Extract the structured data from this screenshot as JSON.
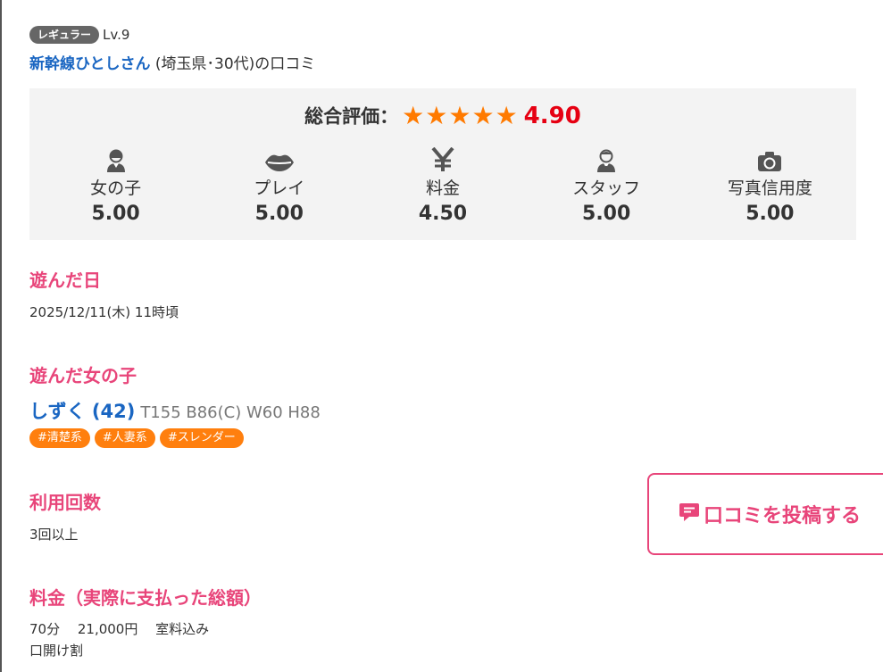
{
  "reviewer": {
    "rank": "レギュラー",
    "level": "Lv.9",
    "name": "新幹線ひとしさん",
    "meta": " (埼玉県･30代)の口コミ"
  },
  "rating": {
    "label": "総合評価：",
    "stars": "★★★★★",
    "score": "4.90",
    "star_color": "#ff7a00",
    "score_color": "#e60012",
    "categories": [
      {
        "icon": "girl-icon",
        "label": "女の子",
        "score": "5.00"
      },
      {
        "icon": "lips-icon",
        "label": "プレイ",
        "score": "5.00"
      },
      {
        "icon": "yen-icon",
        "label": "料金",
        "score": "4.50"
      },
      {
        "icon": "staff-icon",
        "label": "スタッフ",
        "score": "5.00"
      },
      {
        "icon": "camera-icon",
        "label": "写真信用度",
        "score": "5.00"
      }
    ]
  },
  "visit_date": {
    "title": "遊んだ日",
    "value": "2025/12/11(木) 11時頃"
  },
  "girl": {
    "title": "遊んだ女の子",
    "name": "しずく (42)",
    "specs": "T155 B86(C) W60 H88",
    "tags": [
      "#清楚系",
      "#人妻系",
      "#スレンダー"
    ]
  },
  "usage": {
    "title": "利用回数",
    "value": "3回以上"
  },
  "price": {
    "title": "料金（実際に支払った総額）",
    "line1": "70分　 21,000円　 室料込み",
    "line2": "口開け割"
  },
  "post_button": {
    "label": "口コミを投稿する",
    "icon": "comment-icon"
  },
  "colors": {
    "accent_pink": "#e8457a",
    "link_blue": "#1a66c2",
    "tag_orange": "#ff7f0e"
  }
}
